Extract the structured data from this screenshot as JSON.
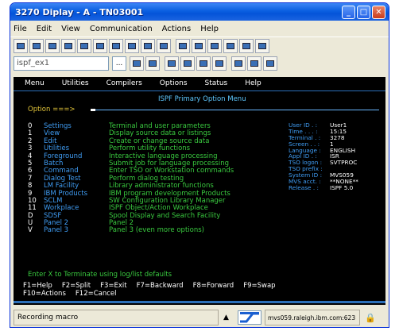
{
  "window": {
    "title": "3270 Diplay - A - TN03001"
  },
  "titlebar_buttons": {
    "minimize": "_",
    "maximize": "□",
    "close": "✕"
  },
  "menubar": [
    "File",
    "Edit",
    "View",
    "Communication",
    "Actions",
    "Help"
  ],
  "session": {
    "value": "ispf_ex1",
    "browse": "..."
  },
  "terminal": {
    "menu": [
      "Menu",
      "Utilities",
      "Compilers",
      "Options",
      "Status",
      "Help"
    ],
    "panel_title": "ISPF Primary Option Menu",
    "option_prompt": "Option ===>",
    "options": [
      {
        "key": "0",
        "name": "Settings",
        "desc": "Terminal and user parameters"
      },
      {
        "key": "1",
        "name": "View",
        "desc": "Display source data or listings"
      },
      {
        "key": "2",
        "name": "Edit",
        "desc": "Create or change source data"
      },
      {
        "key": "3",
        "name": "Utilities",
        "desc": "Perform utility functions"
      },
      {
        "key": "4",
        "name": "Foreground",
        "desc": "Interactive language processing"
      },
      {
        "key": "5",
        "name": "Batch",
        "desc": "Submit job for language processing"
      },
      {
        "key": "6",
        "name": "Command",
        "desc": "Enter TSO or Workstation commands"
      },
      {
        "key": "7",
        "name": "Dialog Test",
        "desc": "Perform dialog testing"
      },
      {
        "key": "8",
        "name": "LM Facility",
        "desc": "Library administrator functions"
      },
      {
        "key": "9",
        "name": "IBM Products",
        "desc": "IBM program development Products"
      },
      {
        "key": "10",
        "name": "SCLM",
        "desc": "SW Configuration Library Manager"
      },
      {
        "key": "11",
        "name": "Workplace",
        "desc": "ISPF Object/Action Workplace"
      },
      {
        "key": "D",
        "name": "SDSF",
        "desc": "Spool Display and Search Facility"
      },
      {
        "key": "U",
        "name": "Panel 2",
        "desc": "Panel 2"
      },
      {
        "key": "V",
        "name": "Panel 3",
        "desc": "Panel 3   (even more options)"
      }
    ],
    "info": [
      {
        "label": "User ID . :",
        "value": "User1"
      },
      {
        "label": "Time . . . :",
        "value": "15:15"
      },
      {
        "label": "Terminal . :",
        "value": "3278"
      },
      {
        "label": "Screen . . :",
        "value": "1"
      },
      {
        "label": "Language :",
        "value": "ENGLISH"
      },
      {
        "label": "Appl ID . :",
        "value": "ISR"
      },
      {
        "label": "TSO logon :",
        "value": "SVTPROC"
      },
      {
        "label": "TSO prefix :",
        "value": ""
      },
      {
        "label": "System ID :",
        "value": "MVS059"
      },
      {
        "label": "MVS acct. :",
        "value": "**NONE**"
      },
      {
        "label": "Release . :",
        "value": "ISPF 5.0"
      }
    ],
    "footer_text": "Enter X to Terminate using log/list defaults",
    "fkeys_row1": [
      "F1=Help",
      "F2=Split",
      "F3=Exit",
      "F7=Backward",
      "F8=Forward",
      "F9=Swap"
    ],
    "fkeys_row2": [
      "F10=Actions",
      "F12=Cancel"
    ]
  },
  "statusbar": {
    "message": "Recording macro",
    "arrow": "▲",
    "host": "mvs059.raleigh.ibm.com:623",
    "lock": "🔒"
  }
}
